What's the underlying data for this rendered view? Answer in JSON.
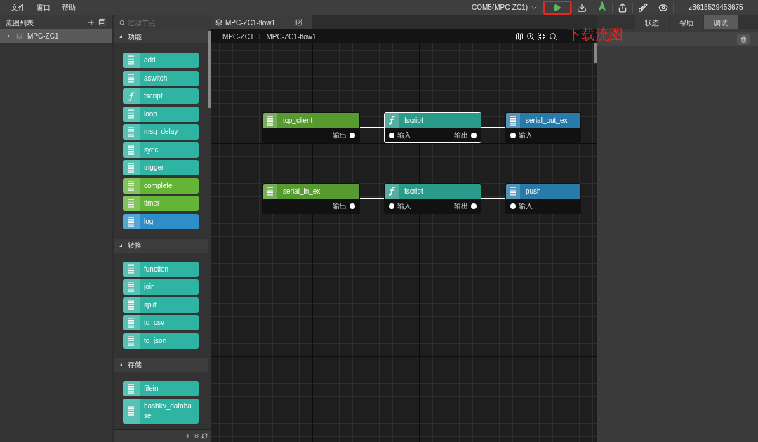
{
  "menu": [
    "文件",
    "窗口",
    "帮助"
  ],
  "toolbar": {
    "port": "COM5(MPC-ZC1)",
    "buttons": [
      {
        "kind": "run",
        "highlighted": true
      },
      {
        "kind": "download",
        "highlighted": false
      },
      {
        "kind": "deploy",
        "highlighted": false
      },
      {
        "kind": "export",
        "highlighted": false
      },
      {
        "kind": "clean",
        "highlighted": false
      },
      {
        "kind": "view",
        "highlighted": false
      }
    ],
    "user": "z8618529453675"
  },
  "annotation": "下载流图",
  "flow_list": {
    "title": "流图列表",
    "items": [
      {
        "label": "MPC-ZC1",
        "expanded": false,
        "selected": true
      }
    ]
  },
  "palette": {
    "placeholder": "过滤节点",
    "sections": [
      {
        "title": "功能",
        "expanded": true,
        "items": [
          {
            "label": "add",
            "kind": "list",
            "color": "#2fb3a2"
          },
          {
            "label": "aswitch",
            "kind": "list",
            "color": "#2fb3a2"
          },
          {
            "label": "fscript",
            "kind": "function",
            "color": "#2fb3a2"
          },
          {
            "label": "loop",
            "kind": "list",
            "color": "#2fb3a2"
          },
          {
            "label": "msg_delay",
            "kind": "list",
            "color": "#2fb3a2"
          },
          {
            "label": "sync",
            "kind": "list",
            "color": "#2fb3a2"
          },
          {
            "label": "trigger",
            "kind": "list",
            "color": "#2fb3a2"
          },
          {
            "label": "complete",
            "kind": "list",
            "color": "#64b536"
          },
          {
            "label": "timer",
            "kind": "list",
            "color": "#64b536"
          },
          {
            "label": "log",
            "kind": "list",
            "color": "#2e8fc8"
          }
        ]
      },
      {
        "title": "转换",
        "expanded": true,
        "items": [
          {
            "label": "function",
            "kind": "list",
            "color": "#2fb3a2"
          },
          {
            "label": "join",
            "kind": "list",
            "color": "#2fb3a2"
          },
          {
            "label": "split",
            "kind": "list",
            "color": "#2fb3a2"
          },
          {
            "label": "to_csv",
            "kind": "list",
            "color": "#2fb3a2"
          },
          {
            "label": "to_json",
            "kind": "list",
            "color": "#2fb3a2"
          }
        ]
      },
      {
        "title": "存储",
        "expanded": true,
        "items": [
          {
            "label": "filein",
            "kind": "list",
            "color": "#2fb3a2"
          },
          {
            "label": "hashkv_database",
            "kind": "list",
            "color": "#2fb3a2"
          }
        ]
      }
    ]
  },
  "tab": {
    "title": "MPC-ZC1-flow1"
  },
  "breadcrumb": [
    "MPC-ZC1",
    "MPC-ZC1-flow1"
  ],
  "flow_rows": [
    [
      {
        "label": "tcp_client",
        "kind": "list",
        "color": "#569a30",
        "output": "输出",
        "selected": false
      },
      {
        "label": "fscript",
        "kind": "function",
        "color": "#2a9a8b",
        "input": "输入",
        "output": "输出",
        "selected": true
      },
      {
        "label": "serial_out_ex",
        "kind": "list",
        "color": "#287aa9",
        "input": "输入",
        "selected": false
      }
    ],
    [
      {
        "label": "serial_in_ex",
        "kind": "list",
        "color": "#569a30",
        "output": "输出",
        "selected": false
      },
      {
        "label": "fscript",
        "kind": "function",
        "color": "#2a9a8b",
        "input": "输入",
        "output": "输出",
        "selected": false
      },
      {
        "label": "push",
        "kind": "list",
        "color": "#287aa9",
        "input": "输入",
        "selected": false
      }
    ]
  ],
  "side_tabs": [
    {
      "label": "状态",
      "selected": false
    },
    {
      "label": "帮助",
      "selected": false
    },
    {
      "label": "调试",
      "selected": true
    }
  ]
}
